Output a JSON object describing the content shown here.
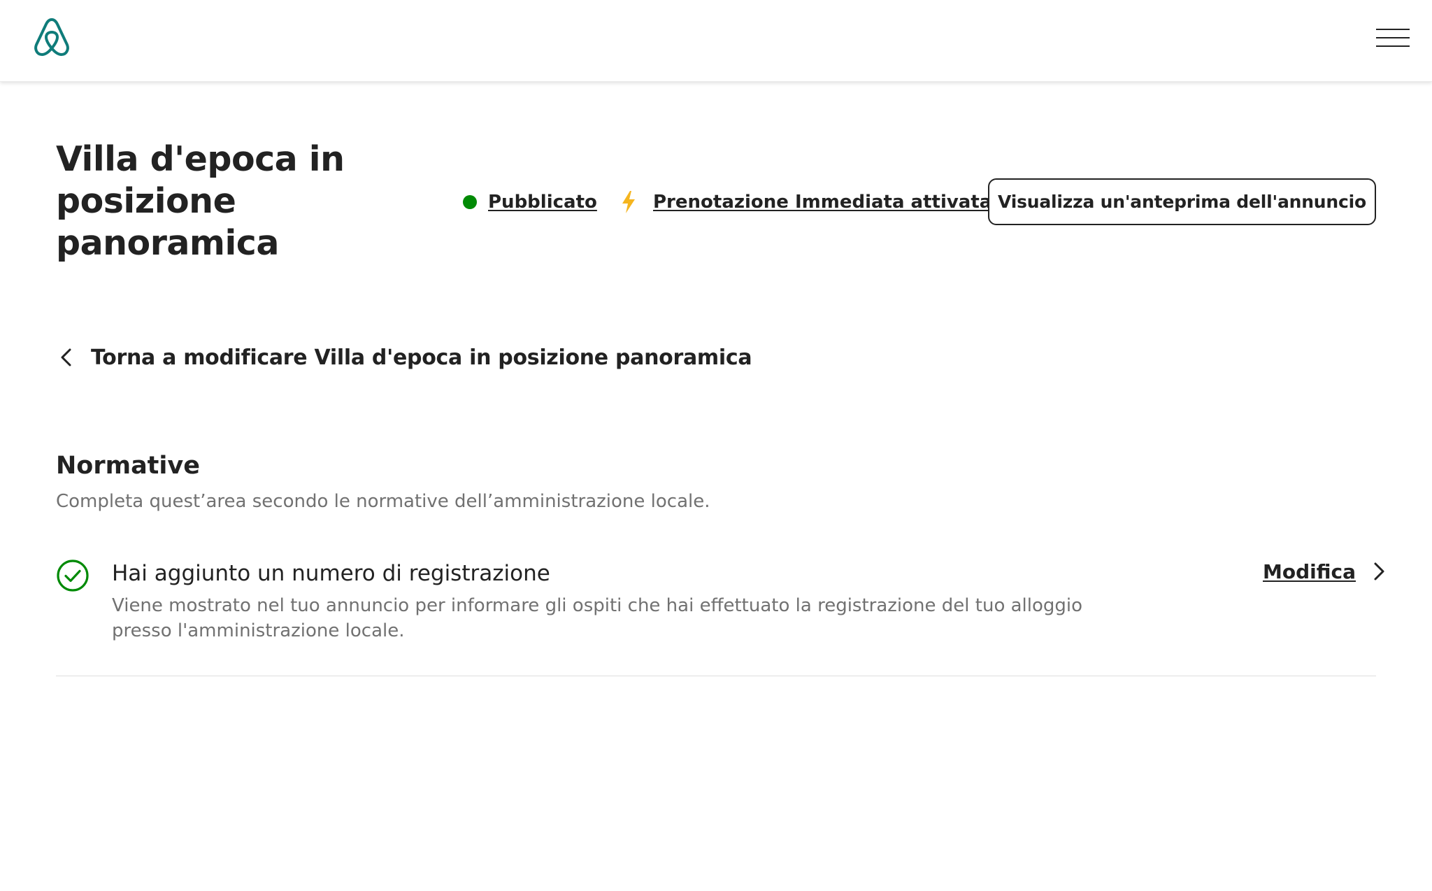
{
  "header": {
    "logo_icon": "airbnb-logo-icon",
    "menu_icon": "hamburger-menu-icon",
    "brand_color": "#0f7c7a"
  },
  "listing": {
    "title": "Villa d'epoca in posizione panoramica",
    "status_label": "Pubblicato",
    "status_color": "#008a05",
    "instant_book_label": "Prenotazione Immediata attivata",
    "instant_book_icon": "lightning-bolt-icon",
    "instant_book_color": "#f5b51f",
    "preview_button_label": "Visualizza un'anteprima dell'annuncio"
  },
  "back_link": {
    "icon": "chevron-left-icon",
    "label": "Torna a modificare Villa d'epoca in posizione panoramica"
  },
  "section": {
    "title": "Normative",
    "subtitle": "Completa quest’area secondo le normative dell’amministrazione locale.",
    "items": [
      {
        "icon": "check-circle-icon",
        "icon_color": "#008a05",
        "title": "Hai aggiunto un numero di registrazione",
        "description": "Viene mostrato nel tuo annuncio per informare gli ospiti che hai effettuato la registrazione del tuo alloggio presso l'amministrazione locale.",
        "action_label": "Modifica",
        "action_icon": "chevron-right-icon"
      }
    ]
  }
}
